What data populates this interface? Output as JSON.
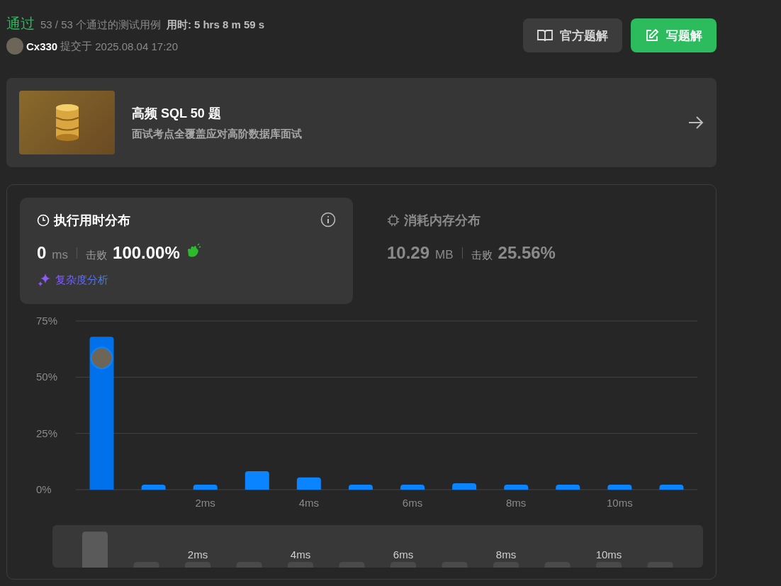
{
  "header": {
    "status": "通过",
    "cases": "53 / 53",
    "cases_label": "个通过的测试用例",
    "time_label": "用时:",
    "time": "5 hrs 8 m 59 s",
    "user": "Cx330",
    "submitted_label": "提交于",
    "submitted_at": "2025.08.04 17:20"
  },
  "buttons": [
    {
      "label": "官方题解",
      "kind": "secondary"
    },
    {
      "label": "写题解",
      "kind": "primary"
    }
  ],
  "banner": {
    "title": "高频 SQL 50 题",
    "subtitle": "面试考点全覆盖应对高阶数据库面试"
  },
  "tabs": [
    {
      "title": "执行用时分布",
      "selected": true,
      "value": "0",
      "unit": "ms",
      "beats_label": "击败",
      "beats": "100.00%",
      "link": "复杂度分析"
    },
    {
      "title": "消耗内存分布",
      "selected": false,
      "value": "10.29",
      "unit": "MB",
      "beats_label": "击败",
      "beats": "25.56%"
    }
  ],
  "chart_data": {
    "type": "bar",
    "x": [
      0,
      1,
      2,
      3,
      4,
      5,
      6,
      7,
      8,
      9,
      10,
      11
    ],
    "values": [
      68,
      2.2,
      2.2,
      8.2,
      5.4,
      2.2,
      2.2,
      2.8,
      2.2,
      2.2,
      2.2,
      2.2
    ],
    "xlim": [
      -0.5,
      11.5
    ],
    "ylim": [
      0,
      75
    ],
    "yticks": [
      {
        "value": 0,
        "label": "0%"
      },
      {
        "value": 25,
        "label": "25%"
      },
      {
        "value": 50,
        "label": "50%"
      },
      {
        "value": 75,
        "label": "75%"
      }
    ],
    "xticks": [
      {
        "value": 2,
        "label": "2ms"
      },
      {
        "value": 4,
        "label": "4ms"
      },
      {
        "value": 6,
        "label": "6ms"
      },
      {
        "value": 8,
        "label": "8ms"
      },
      {
        "value": 10,
        "label": "10ms"
      }
    ]
  },
  "overview_labels": [
    "2ms",
    "4ms",
    "6ms",
    "8ms",
    "10ms"
  ]
}
